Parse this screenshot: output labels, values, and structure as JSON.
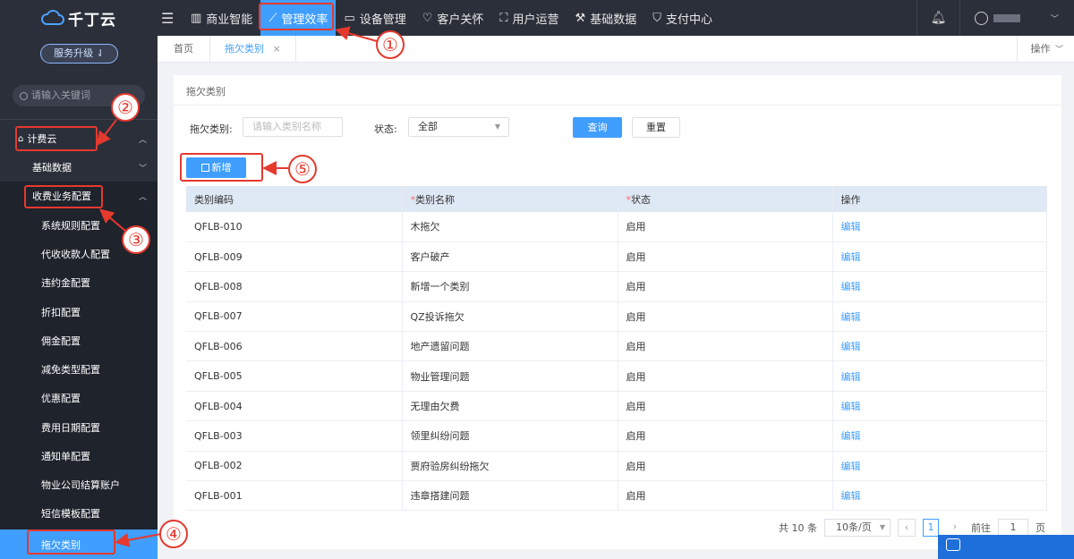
{
  "brand": {
    "name": "千丁云",
    "upgrade_label": "服务升级 ⇃"
  },
  "search": {
    "placeholder": "请输入关键词"
  },
  "sidebar": {
    "top": {
      "label": "计费云"
    },
    "groups": [
      {
        "label": "基础数据"
      },
      {
        "label": "收费业务配置"
      }
    ],
    "items": [
      {
        "label": "系统规则配置"
      },
      {
        "label": "代收收款人配置"
      },
      {
        "label": "违约金配置"
      },
      {
        "label": "折扣配置"
      },
      {
        "label": "佣金配置"
      },
      {
        "label": "减免类型配置"
      },
      {
        "label": "优惠配置"
      },
      {
        "label": "费用日期配置"
      },
      {
        "label": "通知单配置"
      },
      {
        "label": "物业公司结算账户"
      },
      {
        "label": "短信模板配置"
      },
      {
        "label": "拖欠类别"
      }
    ]
  },
  "topnav": [
    {
      "label": "商业智能",
      "icon": "chart-icon"
    },
    {
      "label": "管理效率",
      "icon": "trend-icon"
    },
    {
      "label": "设备管理",
      "icon": "device-icon"
    },
    {
      "label": "客户关怀",
      "icon": "heart-icon"
    },
    {
      "label": "用户运营",
      "icon": "users-icon"
    },
    {
      "label": "基础数据",
      "icon": "wrench-icon"
    },
    {
      "label": "支付中心",
      "icon": "shield-icon"
    }
  ],
  "tabs": [
    {
      "label": "首页"
    },
    {
      "label": "拖欠类别",
      "close": "×"
    }
  ],
  "tabs_ops": "操作",
  "page": {
    "title": "拖欠类别",
    "filter": {
      "category_label": "拖欠类别:",
      "category_placeholder": "请输入类别名称",
      "status_label": "状态:",
      "status_value": "全部",
      "query_label": "查询",
      "reset_label": "重置"
    },
    "add_label": "新增"
  },
  "table": {
    "columns": [
      "类别编码",
      "类别名称",
      "状态",
      "操作"
    ],
    "required_mark": "*",
    "rows": [
      {
        "code": "QFLB-010",
        "name": "木拖欠",
        "status": "启用",
        "op": "编辑"
      },
      {
        "code": "QFLB-009",
        "name": "客户破产",
        "status": "启用",
        "op": "编辑"
      },
      {
        "code": "QFLB-008",
        "name": "新增一个类别",
        "status": "启用",
        "op": "编辑"
      },
      {
        "code": "QFLB-007",
        "name": "QZ投诉拖欠",
        "status": "启用",
        "op": "编辑"
      },
      {
        "code": "QFLB-006",
        "name": "地产遗留问题",
        "status": "启用",
        "op": "编辑"
      },
      {
        "code": "QFLB-005",
        "name": "物业管理问题",
        "status": "启用",
        "op": "编辑"
      },
      {
        "code": "QFLB-004",
        "name": "无理由欠费",
        "status": "启用",
        "op": "编辑"
      },
      {
        "code": "QFLB-003",
        "name": "领里纠纷问题",
        "status": "启用",
        "op": "编辑"
      },
      {
        "code": "QFLB-002",
        "name": "贾府验房纠纷拖欠",
        "status": "启用",
        "op": "编辑"
      },
      {
        "code": "QFLB-001",
        "name": "违章搭建问题",
        "status": "启用",
        "op": "编辑"
      }
    ]
  },
  "pagination": {
    "total_text": "共 10 条",
    "page_size": "10条/页",
    "current_page": "1",
    "goto_label": "前往",
    "goto_value": "1",
    "page_unit": "页"
  },
  "annotations": [
    "①",
    "②",
    "③",
    "④",
    "⑤"
  ],
  "colors": {
    "accent": "#409eff",
    "sidebar": "#2b2f3a",
    "annotation": "#e5392e"
  }
}
